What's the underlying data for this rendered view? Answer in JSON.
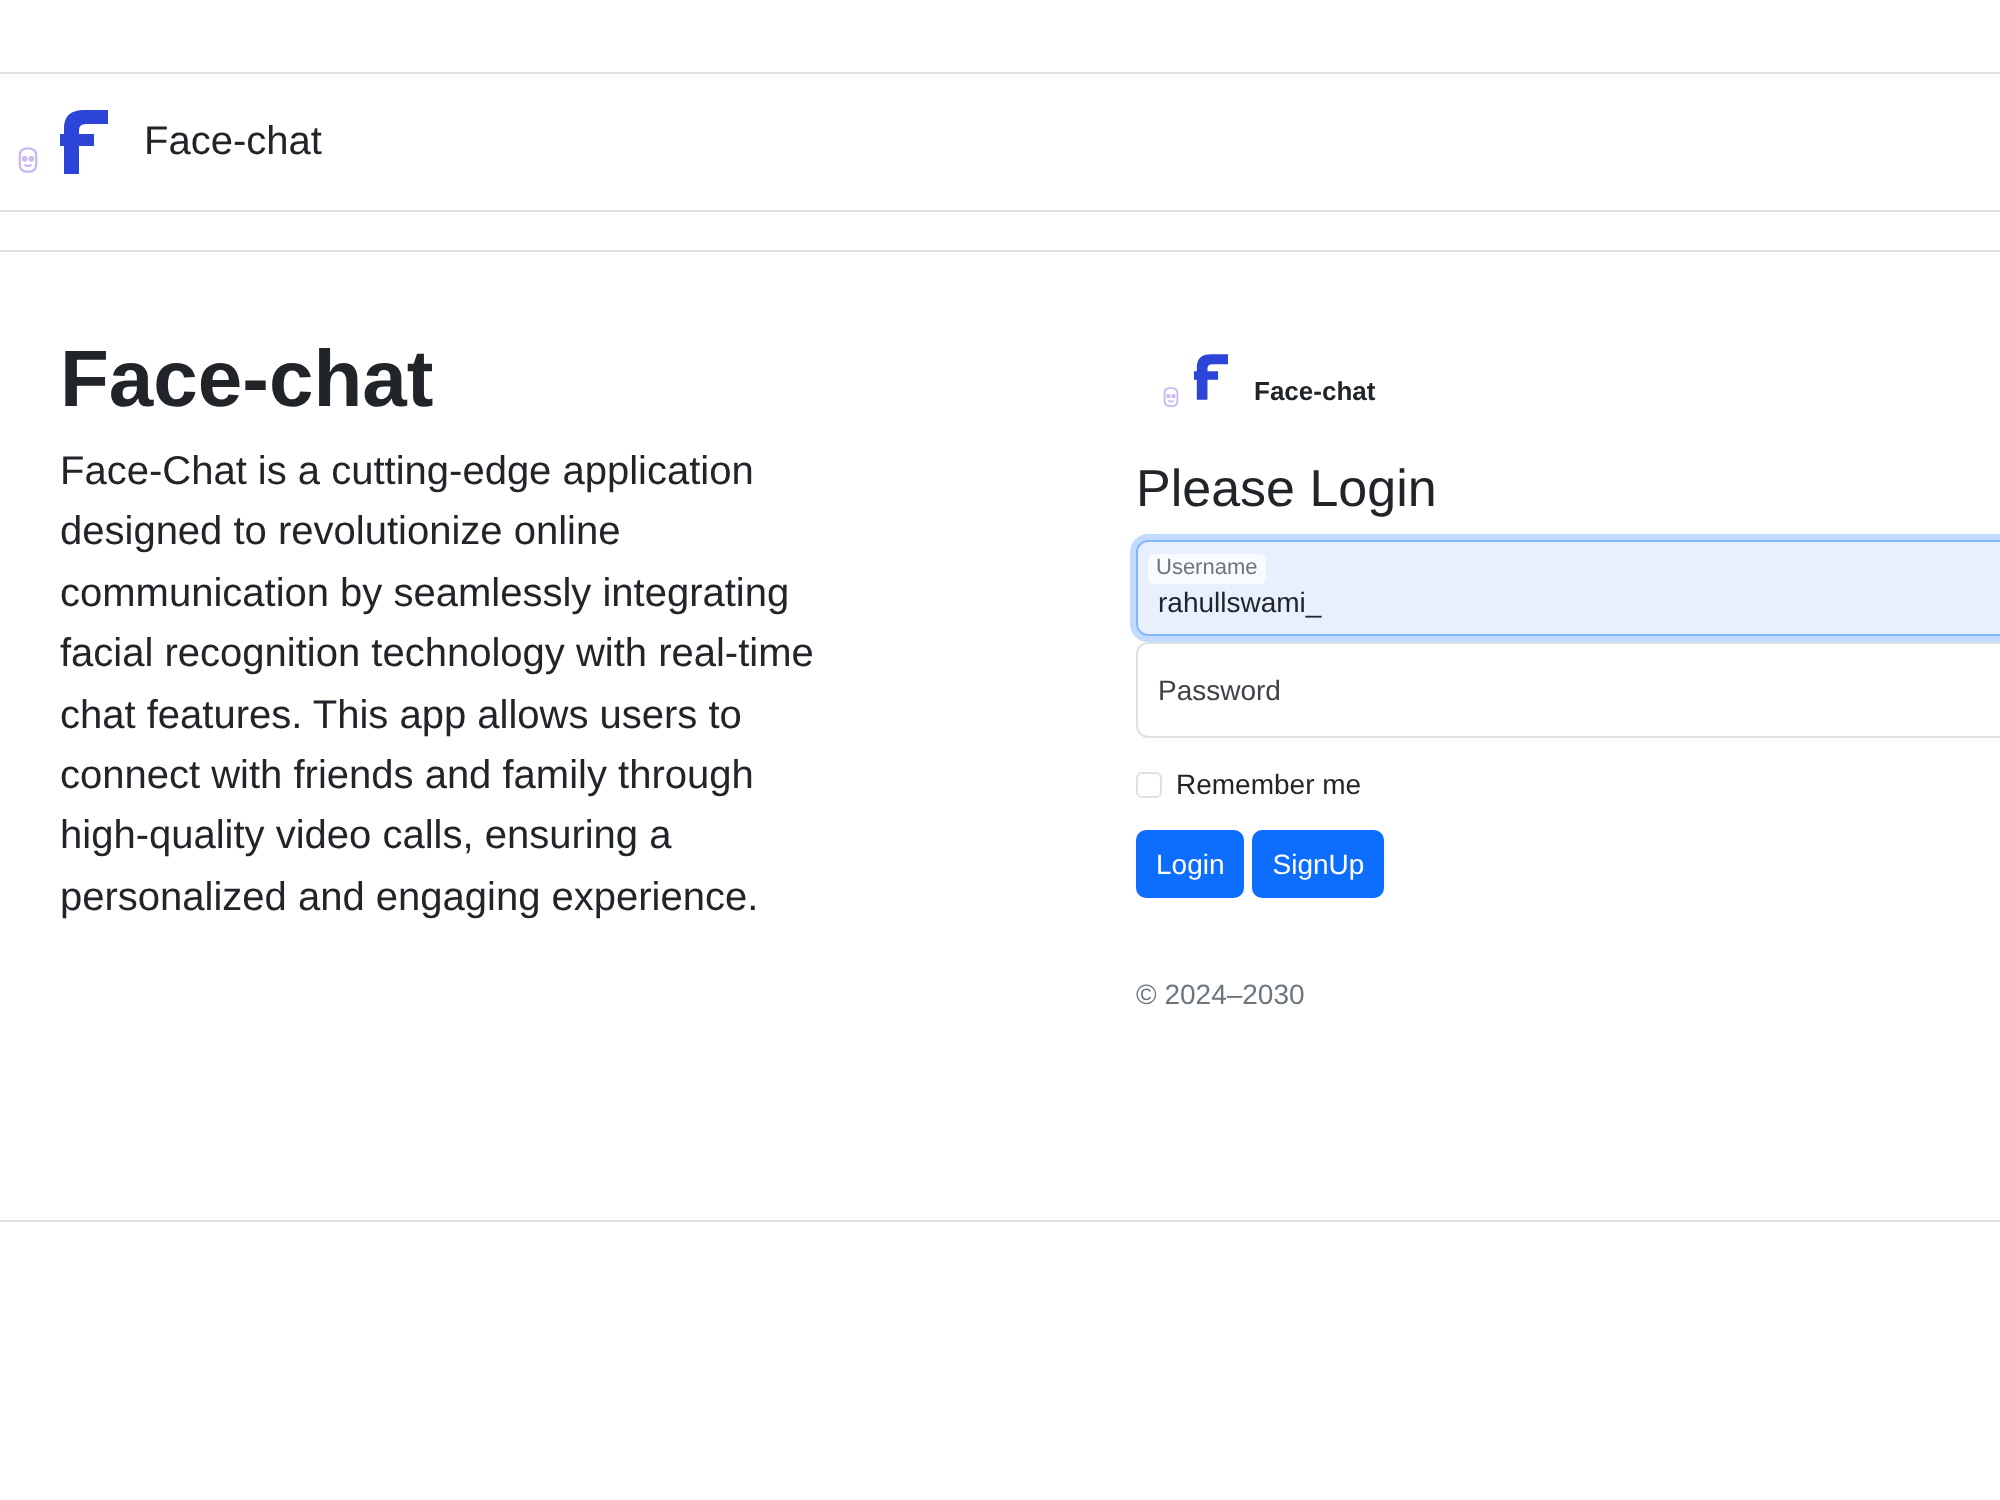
{
  "navbar": {
    "brand": "Face-chat"
  },
  "intro": {
    "title": "Face-chat",
    "text": "Face-Chat is a cutting-edge application designed to revolutionize online communication by seamlessly integrating facial recognition technology with real-time chat features. This app allows users to connect with friends and family through high-quality video calls, ensuring a personalized and engaging experience."
  },
  "login": {
    "brand": "Face-chat",
    "title": "Please Login",
    "fields": [
      {
        "label": "Username",
        "value": "rahullswami_",
        "focused": true
      },
      {
        "placeholder": "Password",
        "focused": false
      }
    ],
    "remember": {
      "label": "Remember me",
      "checked": false
    },
    "buttons": [
      "Login",
      "SignUp"
    ],
    "footer": "© 2024–2030"
  }
}
